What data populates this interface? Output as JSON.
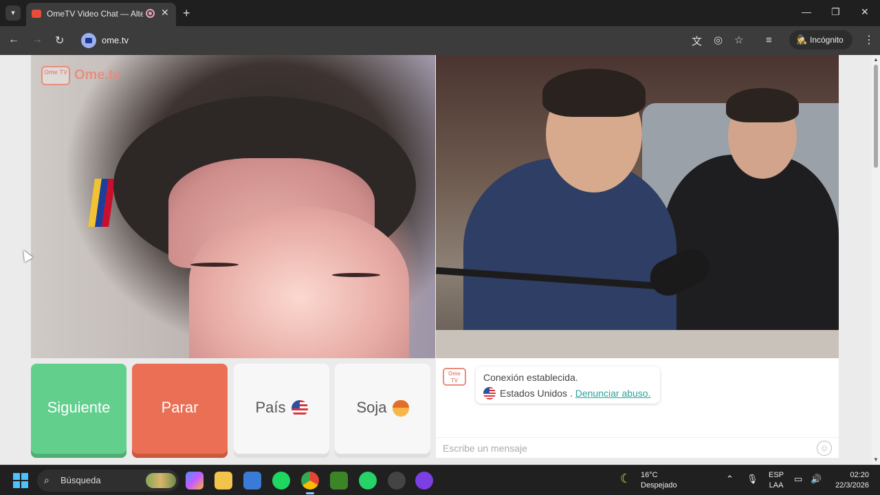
{
  "browser": {
    "tab_title": "OmeTV Video Chat — Alternativa a Omegle",
    "tab_close": "✕",
    "new_tab": "+",
    "url": "ome.tv",
    "incognito_label": "Incógnito"
  },
  "page": {
    "logo_text": "Ome.tv",
    "logo_badge": "Ome TV",
    "buttons": {
      "next": "Siguiente",
      "stop": "Parar",
      "country": "País",
      "gender": "Soja"
    },
    "chat": {
      "status": "Conexión establecida.",
      "country": "Estados Unidos .",
      "report_link": "Denunciar abuso.",
      "input_placeholder": "Escribe un mensaje"
    }
  },
  "taskbar": {
    "search_label": "Búsqueda",
    "weather_temp": "16°C",
    "weather_desc": "Despejado",
    "lang_1": "ESP",
    "lang_2": "LAA",
    "time": "02:20",
    "date": "22/3/2026"
  },
  "colors": {
    "next_button": "#63cf8d",
    "stop_button": "#ea6f55",
    "link": "#2aa29a",
    "logo": "#e98b7d"
  }
}
